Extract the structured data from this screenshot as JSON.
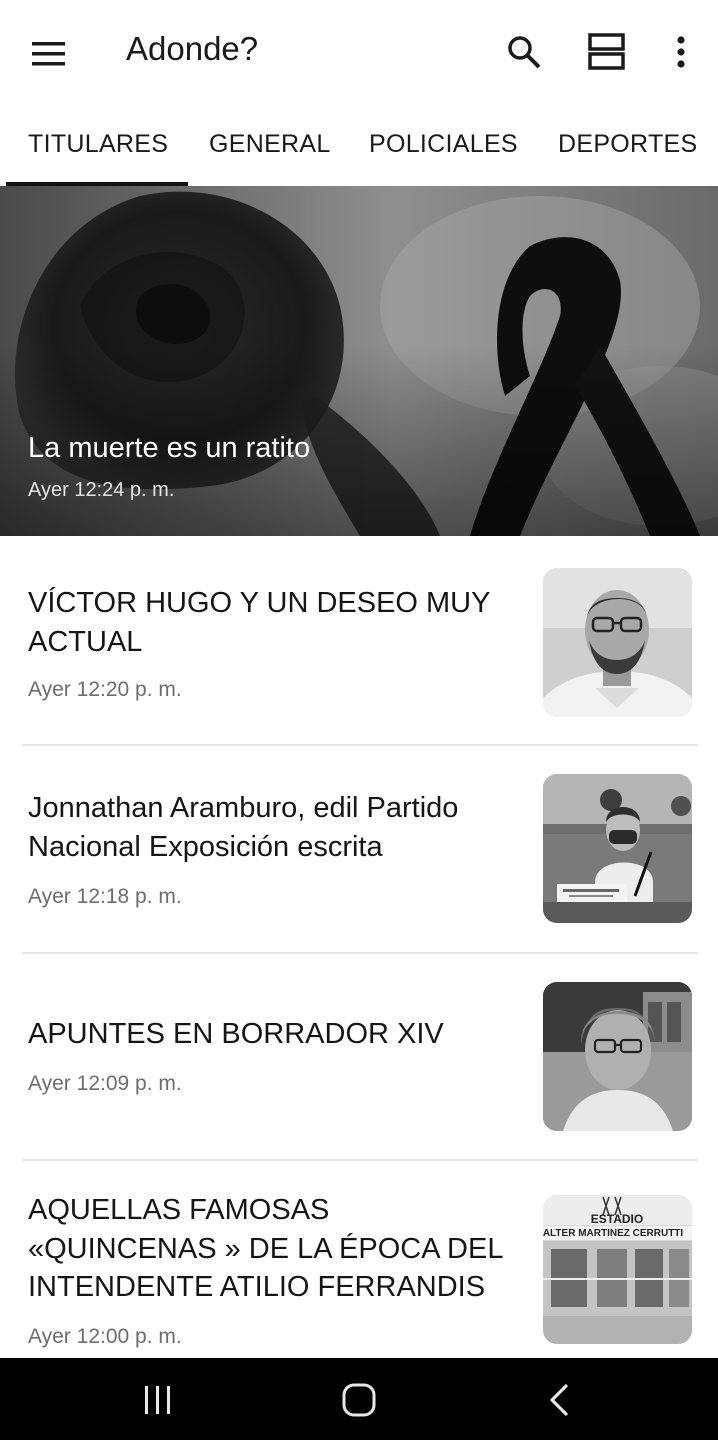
{
  "app": {
    "title": "Adonde?"
  },
  "icons": {
    "menu": "hamburger-menu-icon",
    "search": "search-icon",
    "view": "view-toggle-icon",
    "more": "more-vert-icon"
  },
  "tabs": [
    {
      "label": "TITULARES",
      "selected": true
    },
    {
      "label": "GENERAL"
    },
    {
      "label": "POLICIALES"
    },
    {
      "label": "DEPORTES"
    }
  ],
  "hero": {
    "title": "La muerte es un ratito",
    "time": "Ayer 12:24 p. m."
  },
  "articles": [
    {
      "title": "VÍCTOR HUGO Y UN DESEO MUY ACTUAL",
      "time": "Ayer 12:20 p. m."
    },
    {
      "title": "Jonnathan Aramburo, edil Partido Nacional Exposición escrita",
      "time": "Ayer 12:18 p. m."
    },
    {
      "title": "APUNTES EN BORRADOR XIV",
      "time": "Ayer 12:09 p. m."
    },
    {
      "title": "AQUELLAS FAMOSAS «QUINCENAS » DE LA ÉPOCA DEL INTENDENTE ATILIO FERRANDIS",
      "time": "Ayer 12:00 p. m."
    }
  ],
  "thumb_texts": {
    "stadium_line1": "ESTADIO",
    "stadium_line2": "ALTER MARTINEZ CERRUTTI"
  },
  "system_nav": {
    "recents": "recents-icon",
    "home": "home-icon",
    "back": "back-icon"
  },
  "colors": {
    "accent": "#111111",
    "timestamp": "#6d6d6d",
    "divider": "#e6e6e6",
    "nav_bg": "#000000"
  }
}
